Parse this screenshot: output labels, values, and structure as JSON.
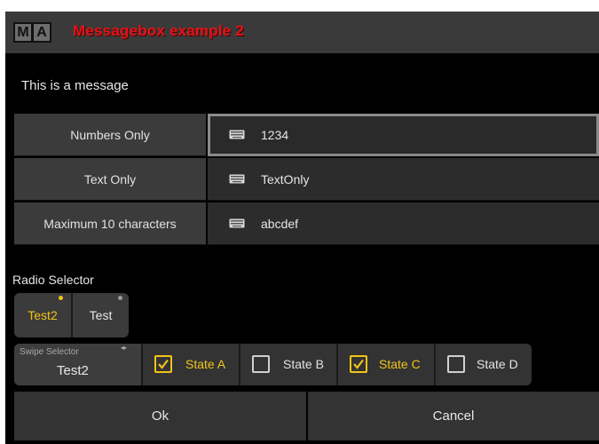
{
  "titlebar": {
    "logo_m": "M",
    "logo_a": "A",
    "title": "Messagebox example 2",
    "title_color": "#e0141a"
  },
  "message": "This is a message",
  "inputs": [
    {
      "label": "Numbers Only",
      "value": "1234",
      "icon": "keyboard-icon",
      "focused": true
    },
    {
      "label": "Text Only",
      "value": "TextOnly",
      "icon": "keyboard-icon",
      "focused": false
    },
    {
      "label": "Maximum 10 characters",
      "value": "abcdef",
      "icon": "keyboard-icon",
      "focused": false
    }
  ],
  "radio": {
    "title": "Radio Selector",
    "options": [
      "Test2",
      "Test"
    ],
    "selected": "Test2"
  },
  "swipe_selector": {
    "title": "Swipe Selector",
    "value": "Test2"
  },
  "states": [
    {
      "label": "State A",
      "checked": true
    },
    {
      "label": "State B",
      "checked": false
    },
    {
      "label": "State C",
      "checked": true
    },
    {
      "label": "State D",
      "checked": false
    }
  ],
  "buttons": {
    "ok": "Ok",
    "cancel": "Cancel"
  },
  "colors": {
    "accent": "#f0c419",
    "background": "#000000",
    "panel": "#3b3b3b"
  }
}
